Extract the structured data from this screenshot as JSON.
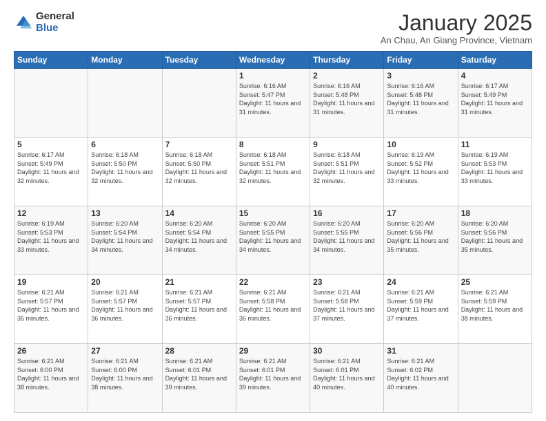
{
  "header": {
    "logo_general": "General",
    "logo_blue": "Blue",
    "title": "January 2025",
    "subtitle": "An Chau, An Giang Province, Vietnam"
  },
  "days_of_week": [
    "Sunday",
    "Monday",
    "Tuesday",
    "Wednesday",
    "Thursday",
    "Friday",
    "Saturday"
  ],
  "weeks": [
    [
      {
        "day": "",
        "info": ""
      },
      {
        "day": "",
        "info": ""
      },
      {
        "day": "",
        "info": ""
      },
      {
        "day": "1",
        "info": "Sunrise: 6:16 AM\nSunset: 5:47 PM\nDaylight: 11 hours and 31 minutes."
      },
      {
        "day": "2",
        "info": "Sunrise: 6:16 AM\nSunset: 5:48 PM\nDaylight: 11 hours and 31 minutes."
      },
      {
        "day": "3",
        "info": "Sunrise: 6:16 AM\nSunset: 5:48 PM\nDaylight: 11 hours and 31 minutes."
      },
      {
        "day": "4",
        "info": "Sunrise: 6:17 AM\nSunset: 5:49 PM\nDaylight: 11 hours and 31 minutes."
      }
    ],
    [
      {
        "day": "5",
        "info": "Sunrise: 6:17 AM\nSunset: 5:49 PM\nDaylight: 11 hours and 32 minutes."
      },
      {
        "day": "6",
        "info": "Sunrise: 6:18 AM\nSunset: 5:50 PM\nDaylight: 11 hours and 32 minutes."
      },
      {
        "day": "7",
        "info": "Sunrise: 6:18 AM\nSunset: 5:50 PM\nDaylight: 11 hours and 32 minutes."
      },
      {
        "day": "8",
        "info": "Sunrise: 6:18 AM\nSunset: 5:51 PM\nDaylight: 11 hours and 32 minutes."
      },
      {
        "day": "9",
        "info": "Sunrise: 6:18 AM\nSunset: 5:51 PM\nDaylight: 11 hours and 32 minutes."
      },
      {
        "day": "10",
        "info": "Sunrise: 6:19 AM\nSunset: 5:52 PM\nDaylight: 11 hours and 33 minutes."
      },
      {
        "day": "11",
        "info": "Sunrise: 6:19 AM\nSunset: 5:53 PM\nDaylight: 11 hours and 33 minutes."
      }
    ],
    [
      {
        "day": "12",
        "info": "Sunrise: 6:19 AM\nSunset: 5:53 PM\nDaylight: 11 hours and 33 minutes."
      },
      {
        "day": "13",
        "info": "Sunrise: 6:20 AM\nSunset: 5:54 PM\nDaylight: 11 hours and 34 minutes."
      },
      {
        "day": "14",
        "info": "Sunrise: 6:20 AM\nSunset: 5:54 PM\nDaylight: 11 hours and 34 minutes."
      },
      {
        "day": "15",
        "info": "Sunrise: 6:20 AM\nSunset: 5:55 PM\nDaylight: 11 hours and 34 minutes."
      },
      {
        "day": "16",
        "info": "Sunrise: 6:20 AM\nSunset: 5:55 PM\nDaylight: 11 hours and 34 minutes."
      },
      {
        "day": "17",
        "info": "Sunrise: 6:20 AM\nSunset: 5:56 PM\nDaylight: 11 hours and 35 minutes."
      },
      {
        "day": "18",
        "info": "Sunrise: 6:20 AM\nSunset: 5:56 PM\nDaylight: 11 hours and 35 minutes."
      }
    ],
    [
      {
        "day": "19",
        "info": "Sunrise: 6:21 AM\nSunset: 5:57 PM\nDaylight: 11 hours and 35 minutes."
      },
      {
        "day": "20",
        "info": "Sunrise: 6:21 AM\nSunset: 5:57 PM\nDaylight: 11 hours and 36 minutes."
      },
      {
        "day": "21",
        "info": "Sunrise: 6:21 AM\nSunset: 5:57 PM\nDaylight: 11 hours and 36 minutes."
      },
      {
        "day": "22",
        "info": "Sunrise: 6:21 AM\nSunset: 5:58 PM\nDaylight: 11 hours and 36 minutes."
      },
      {
        "day": "23",
        "info": "Sunrise: 6:21 AM\nSunset: 5:58 PM\nDaylight: 11 hours and 37 minutes."
      },
      {
        "day": "24",
        "info": "Sunrise: 6:21 AM\nSunset: 5:59 PM\nDaylight: 11 hours and 37 minutes."
      },
      {
        "day": "25",
        "info": "Sunrise: 6:21 AM\nSunset: 5:59 PM\nDaylight: 11 hours and 38 minutes."
      }
    ],
    [
      {
        "day": "26",
        "info": "Sunrise: 6:21 AM\nSunset: 6:00 PM\nDaylight: 11 hours and 38 minutes."
      },
      {
        "day": "27",
        "info": "Sunrise: 6:21 AM\nSunset: 6:00 PM\nDaylight: 11 hours and 38 minutes."
      },
      {
        "day": "28",
        "info": "Sunrise: 6:21 AM\nSunset: 6:01 PM\nDaylight: 11 hours and 39 minutes."
      },
      {
        "day": "29",
        "info": "Sunrise: 6:21 AM\nSunset: 6:01 PM\nDaylight: 11 hours and 39 minutes."
      },
      {
        "day": "30",
        "info": "Sunrise: 6:21 AM\nSunset: 6:01 PM\nDaylight: 11 hours and 40 minutes."
      },
      {
        "day": "31",
        "info": "Sunrise: 6:21 AM\nSunset: 6:02 PM\nDaylight: 11 hours and 40 minutes."
      },
      {
        "day": "",
        "info": ""
      }
    ]
  ]
}
